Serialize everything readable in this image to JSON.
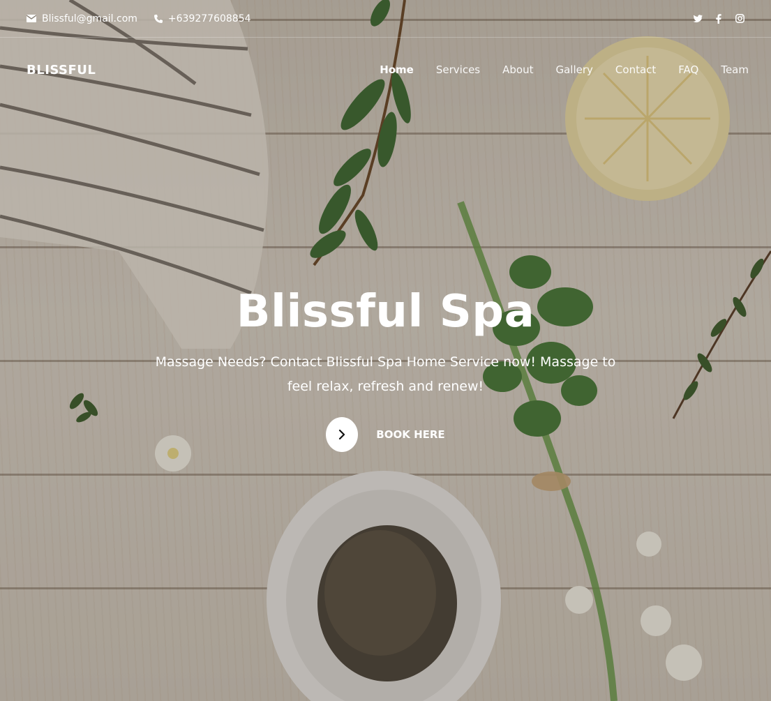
{
  "contact": {
    "email": "Blissful@gmail.com",
    "phone": "+639277608854"
  },
  "social": [
    {
      "icon": "twitter-icon"
    },
    {
      "icon": "facebook-icon"
    },
    {
      "icon": "instagram-icon"
    }
  ],
  "navbar": {
    "brand": "BLISSFUL",
    "items": [
      {
        "label": "Home",
        "active": true
      },
      {
        "label": "Services"
      },
      {
        "label": "About"
      },
      {
        "label": "Gallery"
      },
      {
        "label": "Contact"
      },
      {
        "label": "FAQ"
      },
      {
        "label": "Team"
      }
    ]
  },
  "hero": {
    "title": "Blissful Spa",
    "subtitle": "Massage Needs? Contact Blissful Spa Home Service now! Massage to feel relax, refresh and renew!",
    "cta_label": "BOOK HERE",
    "cta_icon": "chevron-right-icon"
  },
  "colors": {
    "text": "#ffffff",
    "background": "#cfc7ba",
    "leaf": "#3f6b34"
  }
}
